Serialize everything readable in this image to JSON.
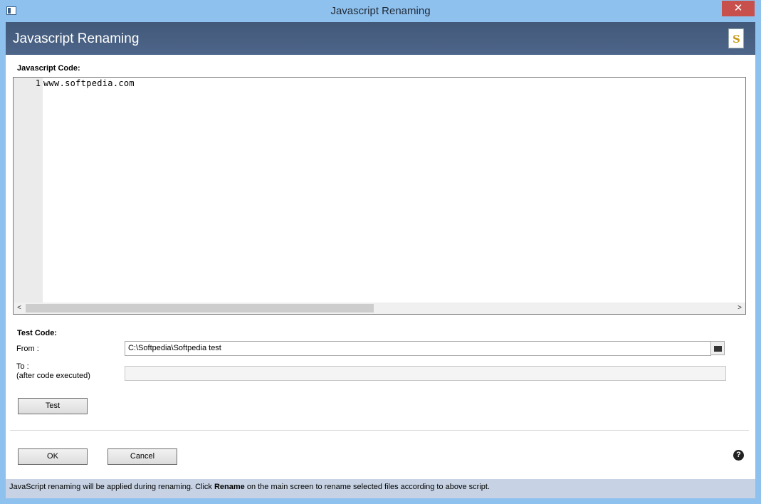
{
  "window": {
    "title": "Javascript Renaming",
    "close_glyph": "✕"
  },
  "header": {
    "title": "Javascript Renaming",
    "icon": "script-scroll-icon"
  },
  "editor": {
    "label": "Javascript Code:",
    "line_numbers": [
      "1"
    ],
    "lines": [
      "www.softpedia.com"
    ],
    "scroll_left_glyph": "<",
    "scroll_right_glyph": ">"
  },
  "test": {
    "label": "Test Code:",
    "from_label": "From :",
    "from_value": "C:\\Softpedia\\Softpedia test",
    "to_label_line1": "To :",
    "to_label_line2": "(after code executed)",
    "to_value": "",
    "test_button": "Test"
  },
  "footer": {
    "ok_button": "OK",
    "cancel_button": "Cancel",
    "help_glyph": "?"
  },
  "status": {
    "text_before": "JavaScript renaming will be applied during renaming. Click ",
    "text_bold": "Rename",
    "text_after": " on the main screen to rename selected files according to above script."
  }
}
